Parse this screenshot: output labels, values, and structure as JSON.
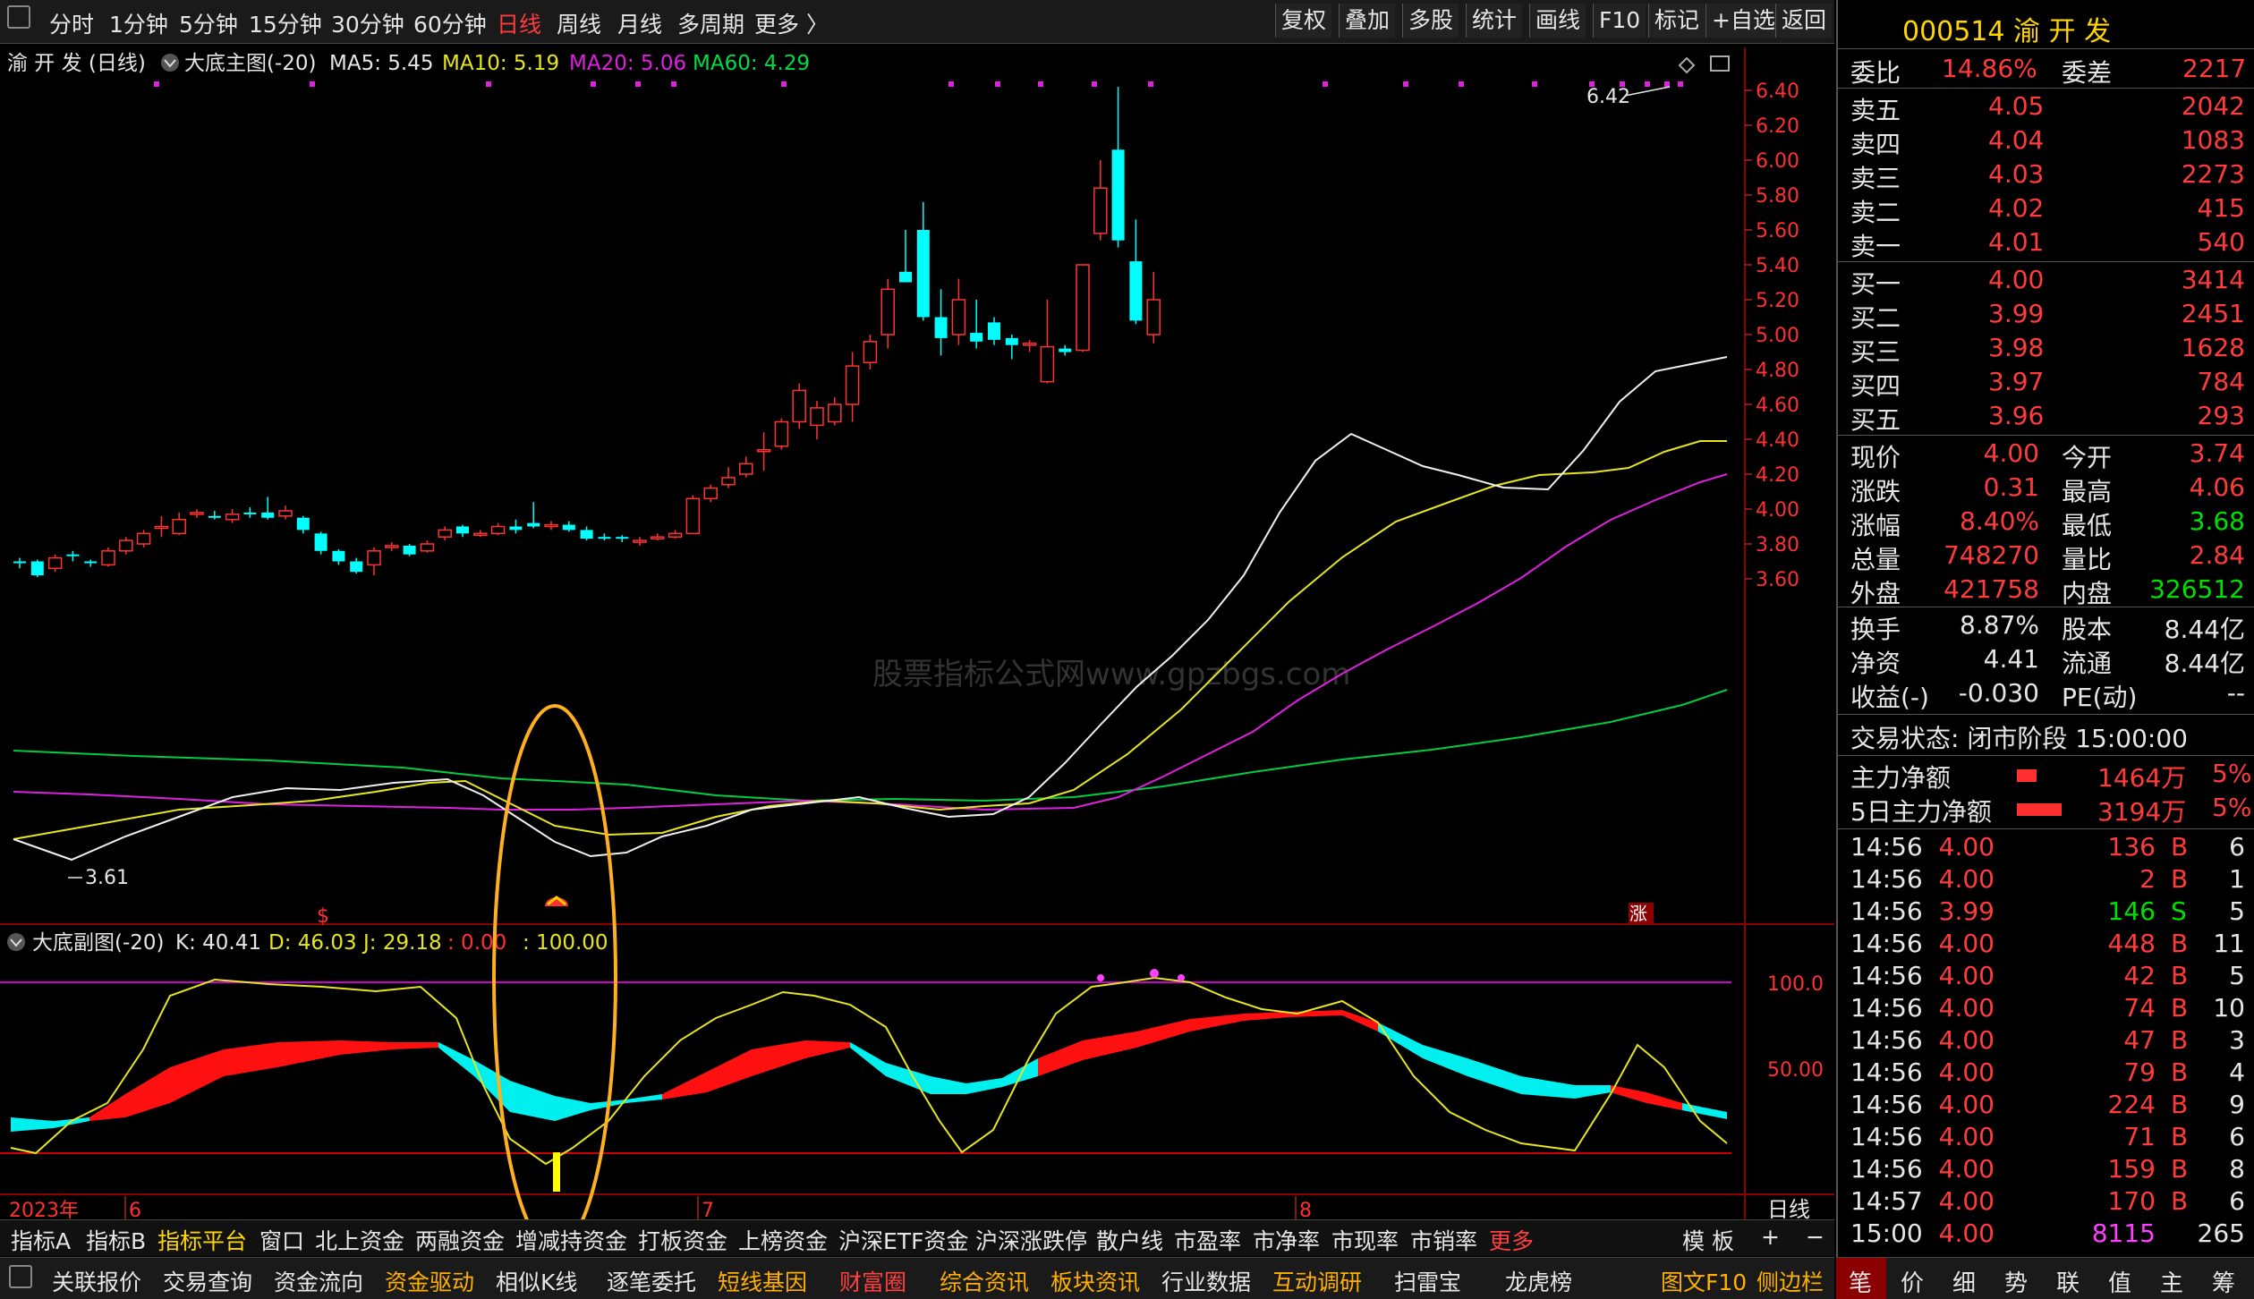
{
  "topbar": {
    "periods": [
      "分时",
      "1分钟",
      "5分钟",
      "15分钟",
      "30分钟",
      "60分钟",
      "日线",
      "周线",
      "月线",
      "多周期",
      "更多 〉"
    ],
    "active_period": "日线",
    "buttons": [
      "复权",
      "叠加",
      "多股",
      "统计",
      "画线",
      "F10",
      "标记",
      "+自选",
      "返回"
    ]
  },
  "main_chart": {
    "stock_label": "渝 开 发 (日线)",
    "indicator": "大底主图(-20)",
    "ma5": "MA5: 5.45",
    "ma10": "MA10: 5.19",
    "ma20": "MA20: 5.06",
    "ma60": "MA60: 4.29",
    "high_label": "6.42",
    "low_label": "3.61",
    "watermark": "股票指标公式网www.gpzbgs.com",
    "signal_s": "$",
    "signal_zhang": "涨",
    "price_ticks": [
      "6.40",
      "6.20",
      "6.00",
      "5.80",
      "5.60",
      "5.40",
      "5.20",
      "5.00",
      "4.80",
      "4.60",
      "4.40",
      "4.20",
      "4.00",
      "3.80",
      "3.60"
    ]
  },
  "sub_chart": {
    "indicator": "大底副图(-20)",
    "k": "K: 40.41",
    "d": "D: 46.03",
    "j": "J: 29.18",
    "v1": ": 0.00",
    "v2": ": 100.00",
    "ticks": [
      "100.0",
      "50.00"
    ]
  },
  "date_axis": {
    "year": "2023年",
    "m6": "6",
    "m7": "7",
    "m8": "8",
    "period": "日线"
  },
  "tabbar1": {
    "items": [
      "指标A",
      "指标B",
      "指标平台",
      "窗口",
      "北上资金",
      "两融资金",
      "增减持资金",
      "打板资金",
      "上榜资金",
      "沪深ETF资金",
      "沪深涨跌停",
      "散户线",
      "市盈率",
      "市净率",
      "市现率",
      "市销率",
      "更多"
    ],
    "right": [
      "模 板",
      "+",
      "−"
    ]
  },
  "tabbar2": {
    "items": [
      "关联报价",
      "交易查询",
      "资金流向",
      "资金驱动",
      "相似K线",
      "逐笔委托",
      "短线基因",
      "财富圈",
      "综合资讯",
      "板块资讯",
      "行业数据",
      "互动调研",
      "扫雷宝",
      "龙虎榜",
      "图文F10",
      "侧边栏"
    ]
  },
  "panel": {
    "code_name": "000514 渝 开 发",
    "weibi_label": "委比",
    "weibi": "14.86%",
    "weicha_label": "委差",
    "weicha": "2217",
    "asks": [
      {
        "label": "卖五",
        "price": "4.05",
        "vol": "2042"
      },
      {
        "label": "卖四",
        "price": "4.04",
        "vol": "1083"
      },
      {
        "label": "卖三",
        "price": "4.03",
        "vol": "2273"
      },
      {
        "label": "卖二",
        "price": "4.02",
        "vol": "415"
      },
      {
        "label": "卖一",
        "price": "4.01",
        "vol": "540"
      }
    ],
    "bids": [
      {
        "label": "买一",
        "price": "4.00",
        "vol": "3414"
      },
      {
        "label": "买二",
        "price": "3.99",
        "vol": "2451"
      },
      {
        "label": "买三",
        "price": "3.98",
        "vol": "1628"
      },
      {
        "label": "买四",
        "price": "3.97",
        "vol": "784"
      },
      {
        "label": "买五",
        "price": "3.96",
        "vol": "293"
      }
    ],
    "quote": [
      {
        "l1": "现价",
        "v1": "4.00",
        "l2": "今开",
        "v2": "3.74"
      },
      {
        "l1": "涨跌",
        "v1": "0.31",
        "l2": "最高",
        "v2": "4.06"
      },
      {
        "l1": "涨幅",
        "v1": "8.40%",
        "l2": "最低",
        "v2": "3.68"
      },
      {
        "l1": "总量",
        "v1": "748270",
        "l2": "量比",
        "v2": "2.84"
      },
      {
        "l1": "外盘",
        "v1": "421758",
        "l2": "内盘",
        "v2": "326512"
      }
    ],
    "info": [
      {
        "l1": "换手",
        "v1": "8.87%",
        "l2": "股本",
        "v2": "8.44亿"
      },
      {
        "l1": "净资",
        "v1": "4.41",
        "l2": "流通",
        "v2": "8.44亿"
      },
      {
        "l1": "收益(-)",
        "v1": "-0.030",
        "l2": "PE(动)",
        "v2": "--"
      }
    ],
    "status": "交易状态: 闭市阶段 15:00:00",
    "zhuli_label": "主力净额",
    "zhuli_val": "1464万",
    "zhuli_pct": "5%",
    "zhuli5_label": "5日主力净额",
    "zhuli5_val": "3194万",
    "zhuli5_pct": "5%",
    "ticks": [
      {
        "t": "14:56",
        "p": "4.00",
        "v": "136",
        "s": "B",
        "n": "6"
      },
      {
        "t": "14:56",
        "p": "4.00",
        "v": "2",
        "s": "B",
        "n": "1"
      },
      {
        "t": "14:56",
        "p": "3.99",
        "v": "146",
        "s": "S",
        "n": "5"
      },
      {
        "t": "14:56",
        "p": "4.00",
        "v": "448",
        "s": "B",
        "n": "11"
      },
      {
        "t": "14:56",
        "p": "4.00",
        "v": "42",
        "s": "B",
        "n": "5"
      },
      {
        "t": "14:56",
        "p": "4.00",
        "v": "74",
        "s": "B",
        "n": "10"
      },
      {
        "t": "14:56",
        "p": "4.00",
        "v": "47",
        "s": "B",
        "n": "3"
      },
      {
        "t": "14:56",
        "p": "4.00",
        "v": "79",
        "s": "B",
        "n": "4"
      },
      {
        "t": "14:56",
        "p": "4.00",
        "v": "224",
        "s": "B",
        "n": "9"
      },
      {
        "t": "14:56",
        "p": "4.00",
        "v": "71",
        "s": "B",
        "n": "6"
      },
      {
        "t": "14:56",
        "p": "4.00",
        "v": "159",
        "s": "B",
        "n": "8"
      },
      {
        "t": "14:57",
        "p": "4.00",
        "v": "170",
        "s": "B",
        "n": "6"
      },
      {
        "t": "15:00",
        "p": "4.00",
        "v": "8115",
        "s": "",
        "n": "265"
      }
    ],
    "bottom_tabs": [
      "笔",
      "价",
      "细",
      "势",
      "联",
      "值",
      "主",
      "筹"
    ]
  }
}
